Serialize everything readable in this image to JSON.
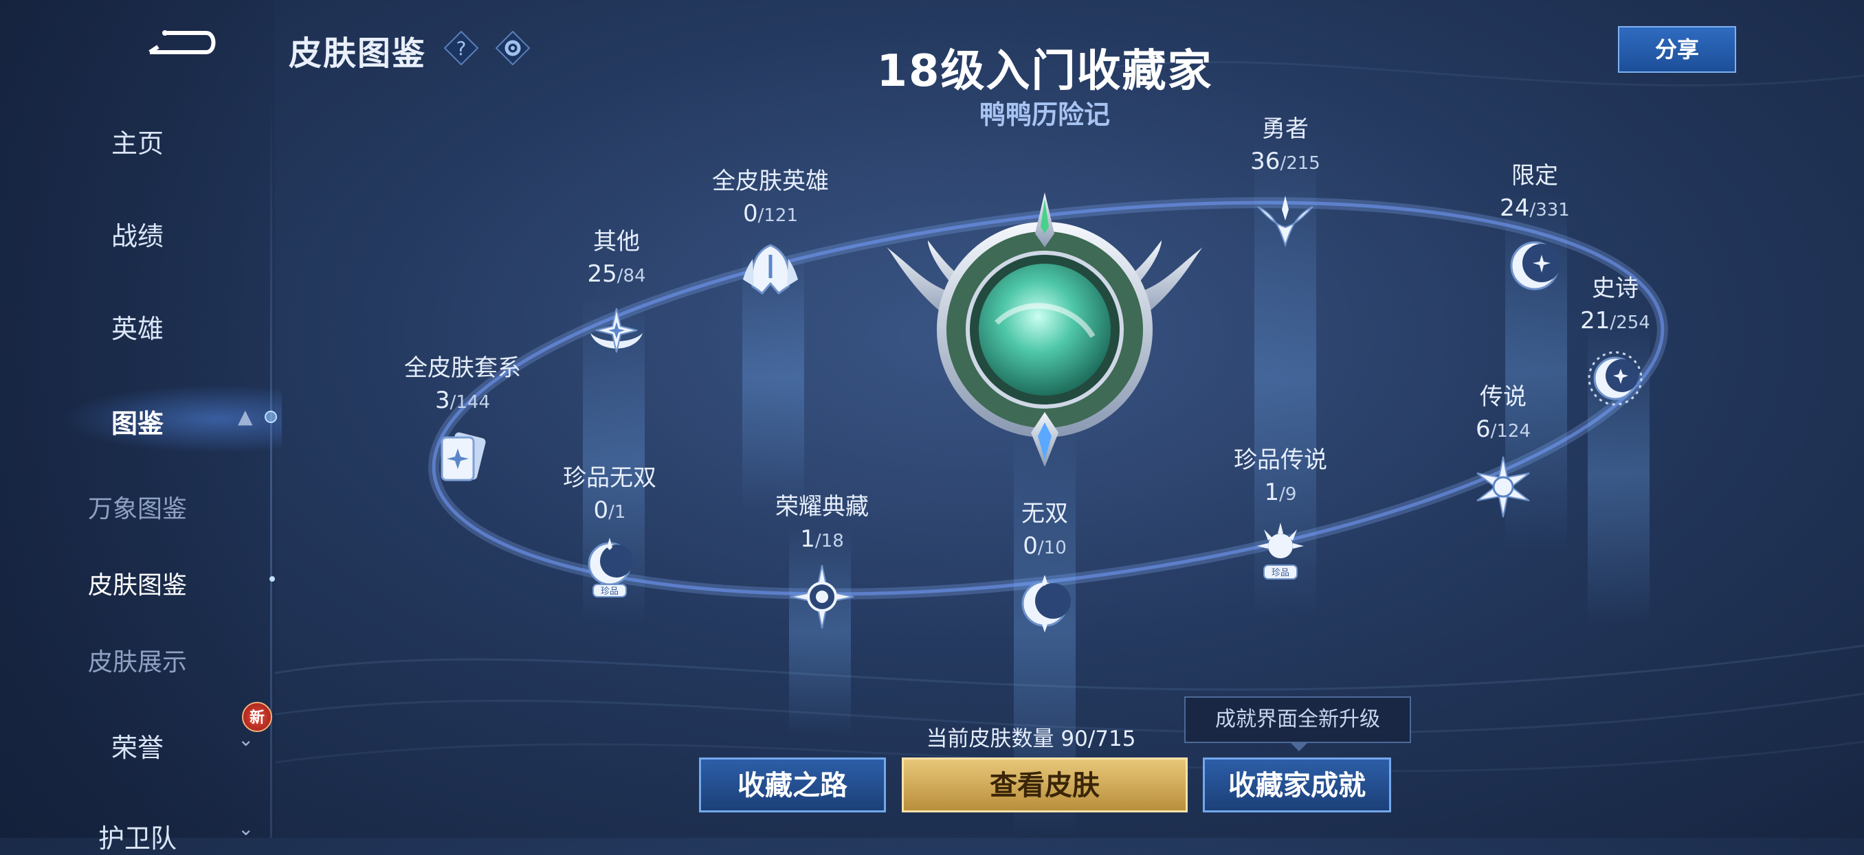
{
  "header": {
    "page_title": "皮肤图鉴",
    "share_label": "分享",
    "main_title": "18级入门收藏家",
    "main_subtitle": "鸭鸭历险记"
  },
  "sidebar": {
    "items": [
      {
        "label": "主页"
      },
      {
        "label": "战绩"
      },
      {
        "label": "英雄"
      },
      {
        "label": "图鉴"
      }
    ],
    "sub_items": [
      {
        "label": "万象图鉴"
      },
      {
        "label": "皮肤图鉴"
      },
      {
        "label": "皮肤展示"
      }
    ],
    "more_items": [
      {
        "label": "荣誉",
        "badge": "新"
      },
      {
        "label": "护卫队"
      }
    ]
  },
  "categories": [
    {
      "name": "全皮肤套系",
      "count": "3",
      "total": "/144",
      "icon": "cards-icon"
    },
    {
      "name": "其他",
      "count": "25",
      "total": "/84",
      "icon": "star-emblem-icon"
    },
    {
      "name": "全皮肤英雄",
      "count": "0",
      "total": "/121",
      "icon": "helmet-icon"
    },
    {
      "name": "珍品无双",
      "count": "0",
      "total": "/1",
      "icon": "moon-treasure-icon"
    },
    {
      "name": "荣耀典藏",
      "count": "1",
      "total": "/18",
      "icon": "compass-star-icon"
    },
    {
      "name": "无双",
      "count": "0",
      "total": "/10",
      "icon": "moon-icon"
    },
    {
      "name": "勇者",
      "count": "36",
      "total": "/215",
      "icon": "winged-star-icon"
    },
    {
      "name": "珍品传说",
      "count": "1",
      "total": "/9",
      "icon": "sun-treasure-icon"
    },
    {
      "name": "限定",
      "count": "24",
      "total": "/331",
      "icon": "crescent-star-icon"
    },
    {
      "name": "传说",
      "count": "6",
      "total": "/124",
      "icon": "sunburst-icon"
    },
    {
      "name": "史诗",
      "count": "21",
      "total": "/254",
      "icon": "crescent-ring-icon"
    }
  ],
  "bottom": {
    "skin_count": "当前皮肤数量 90/715",
    "tooltip": "成就界面全新升级",
    "buttons": {
      "road": "收藏之路",
      "view": "查看皮肤",
      "achievement": "收藏家成就"
    }
  },
  "colors": {
    "accent_blue": "#2c5ea8",
    "gold": "#e8c779",
    "orb_green": "#3fb99a"
  }
}
